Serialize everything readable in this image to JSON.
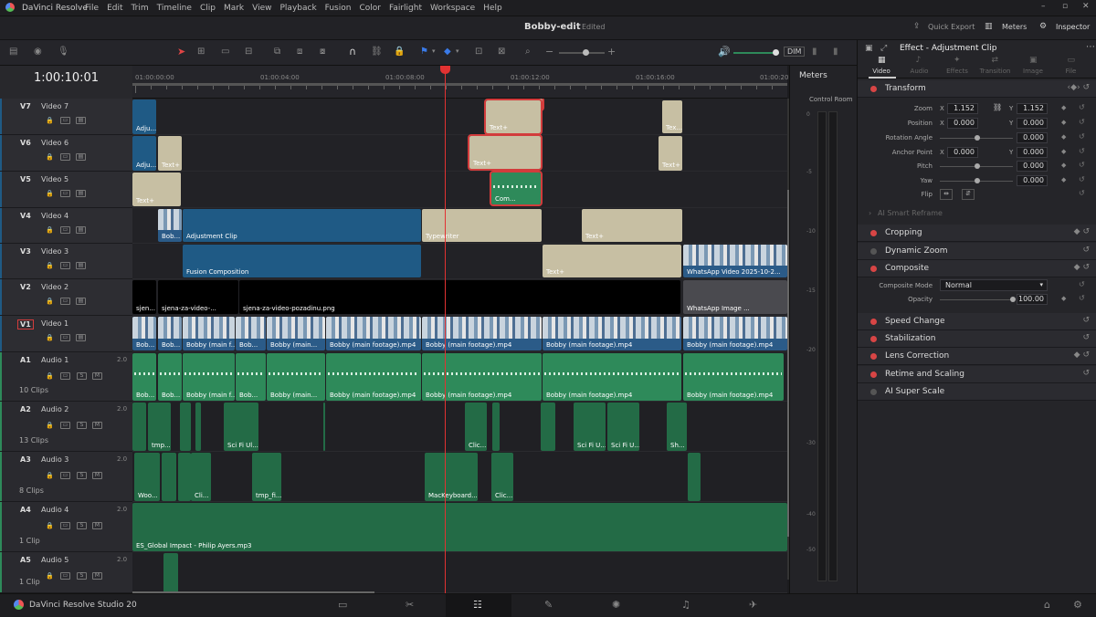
{
  "app_title": "DaVinci Resolve",
  "menu": [
    "File",
    "Edit",
    "Trim",
    "Timeline",
    "Clip",
    "Mark",
    "View",
    "Playback",
    "Fusion",
    "Color",
    "Fairlight",
    "Workspace",
    "Help"
  ],
  "project": {
    "name": "Bobby-edit",
    "status": "Edited"
  },
  "header_right": {
    "quick_export": "Quick Export",
    "meters": "Meters",
    "inspector": "Inspector"
  },
  "toolbar": {
    "dim": "DIM"
  },
  "timecode": "1:00:10:01",
  "ruler_labels": [
    "01:00:00:00",
    "01:00:04:00",
    "01:00:08:00",
    "01:00:12:00",
    "01:00:16:00",
    "01:00:20:0"
  ],
  "tracks": [
    {
      "code": "V7",
      "name": "Video 7"
    },
    {
      "code": "V6",
      "name": "Video 6"
    },
    {
      "code": "V5",
      "name": "Video 5"
    },
    {
      "code": "V4",
      "name": "Video 4"
    },
    {
      "code": "V3",
      "name": "Video 3"
    },
    {
      "code": "V2",
      "name": "Video 2"
    },
    {
      "code": "V1",
      "name": "Video 1"
    },
    {
      "code": "A1",
      "name": "Audio 1",
      "vol": "2.0",
      "count": "10 Clips"
    },
    {
      "code": "A2",
      "name": "Audio 2",
      "vol": "2.0",
      "count": "13 Clips"
    },
    {
      "code": "A3",
      "name": "Audio 3",
      "vol": "2.0",
      "count": "8 Clips"
    },
    {
      "code": "A4",
      "name": "Audio 4",
      "vol": "2.0",
      "count": "1 Clip"
    },
    {
      "code": "A5",
      "name": "Audio 5",
      "vol": "2.0",
      "count": "1 Clip"
    }
  ],
  "clips": {
    "adju": "Adju...",
    "text_plus": "Text+",
    "tex": "Tex...",
    "com": "Com...",
    "bob": "Bob...",
    "adjustment_clip": "Adjustment Clip",
    "typewriter": "Typewriter",
    "fusion_composition": "Fusion Composition",
    "whatsapp_video": "WhatsApp Video 2025-10-2...",
    "sjena_short": "sjen...",
    "sjena_video": "sjena-za-video-...",
    "sjena_png": "sjena-za-video-pozadinu.png",
    "whatsapp_image": "WhatsApp Image ...",
    "bobby_main_f": "Bobby (main f...",
    "bobby_main": "Bobby (main...",
    "bobby_main_mp4": "Bobby (main footage).mp4",
    "tmp": "tmp...",
    "scifi": "Sci Fi Ul...",
    "scifi_u": "Sci Fi U...",
    "clic": "Clic...",
    "sh": "Sh...",
    "woo": "Woo...",
    "cli": "Cli...",
    "tmp_fi": "tmp_fi...",
    "mackeyboard": "MacKeyboard...",
    "global_impact": "ES_Global Impact - Philip Ayers.mp3"
  },
  "meters": {
    "title": "Meters",
    "control_room": "Control Room",
    "scale": [
      "0",
      "-5",
      "-10",
      "-15",
      "-20",
      "-30",
      "-40",
      "-50"
    ]
  },
  "inspector": {
    "title": "Effect - Adjustment Clip",
    "tabs": [
      "Video",
      "Audio",
      "Effects",
      "Transition",
      "Image",
      "File"
    ],
    "transform": {
      "title": "Transform",
      "zoom": {
        "label": "Zoom",
        "x": "1.152",
        "y": "1.152"
      },
      "position": {
        "label": "Position",
        "x": "0.000",
        "y": "0.000"
      },
      "rotation": {
        "label": "Rotation Angle",
        "v": "0.000"
      },
      "anchor": {
        "label": "Anchor Point",
        "x": "0.000",
        "y": "0.000"
      },
      "pitch": {
        "label": "Pitch",
        "v": "0.000"
      },
      "yaw": {
        "label": "Yaw",
        "v": "0.000"
      },
      "flip": {
        "label": "Flip"
      }
    },
    "ai_reframe": "AI Smart Reframe",
    "cropping": "Cropping",
    "dynamic_zoom": "Dynamic Zoom",
    "composite": {
      "title": "Composite",
      "mode_label": "Composite Mode",
      "mode": "Normal",
      "opacity_label": "Opacity",
      "opacity": "100.00"
    },
    "speed_change": "Speed Change",
    "stabilization": "Stabilization",
    "lens_correction": "Lens Correction",
    "retime": "Retime and Scaling",
    "ai_super_scale": "AI Super Scale"
  },
  "bottom": {
    "app": "DaVinci Resolve Studio 20"
  },
  "axis_letters": {
    "x": "X",
    "y": "Y"
  }
}
